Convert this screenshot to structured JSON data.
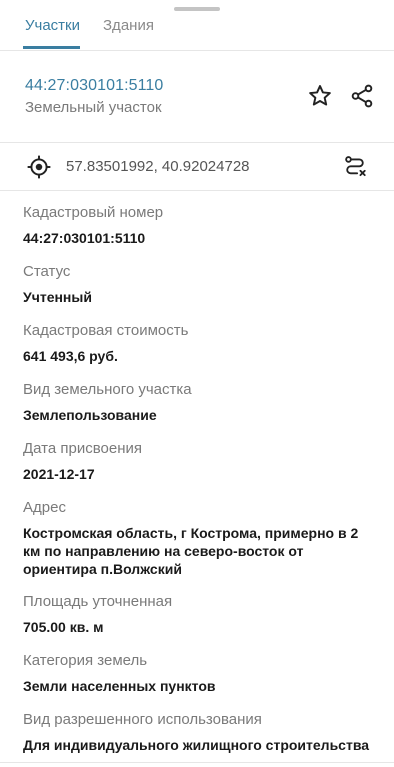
{
  "tabs": [
    {
      "label": "Участки",
      "active": true
    },
    {
      "label": "Здания",
      "active": false
    }
  ],
  "header": {
    "cadastral_number": "44:27:030101:5110",
    "object_type": "Земельный участок"
  },
  "location": {
    "coordinates": "57.83501992, 40.92024728"
  },
  "icons": {
    "favorite": "star-outline-icon",
    "share": "share-icon",
    "locate": "crosshair-icon",
    "route": "route-icon"
  },
  "colors": {
    "accent": "#3a7ea1",
    "label": "#7a7a7a",
    "value": "#1a1a1a",
    "divider": "#e6e6e6"
  },
  "fields": [
    {
      "label": "Кадастровый номер",
      "value": "44:27:030101:5110"
    },
    {
      "label": "Статус",
      "value": "Учтенный"
    },
    {
      "label": "Кадастровая стоимость",
      "value": "641 493,6 руб."
    },
    {
      "label": "Вид земельного участка",
      "value": "Землепользование"
    },
    {
      "label": "Дата присвоения",
      "value": "2021-12-17"
    },
    {
      "label": "Адрес",
      "value": "Костромская область, г Кострома, примерно в 2 км по направлению на северо-восток от ориентира п.Волжский"
    },
    {
      "label": "Площадь уточненная",
      "value": "705.00 кв. м"
    },
    {
      "label": "Категория земель",
      "value": "Земли населенных пунктов"
    },
    {
      "label": "Вид разрешенного использования",
      "value": "Для индивидуального жилищного строительства"
    }
  ]
}
